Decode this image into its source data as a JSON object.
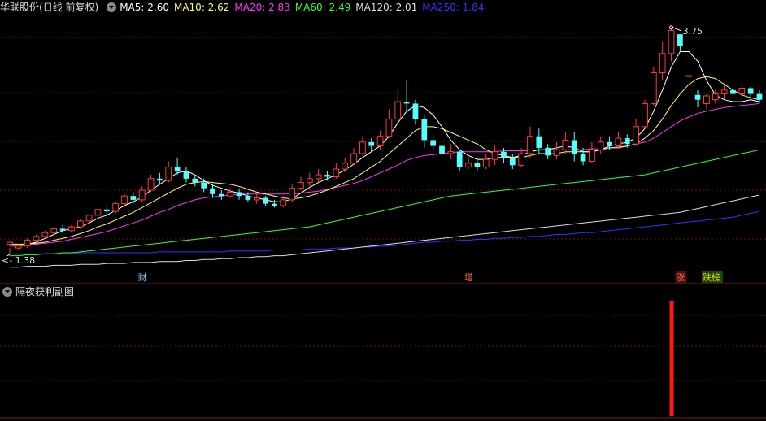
{
  "header": {
    "stock_name": "华联股份",
    "period": "(日线 前复权)",
    "ma": [
      {
        "name": "MA5",
        "value": "2.60",
        "color": "#ffffff"
      },
      {
        "name": "MA10",
        "value": "2.62",
        "color": "#ffff66"
      },
      {
        "name": "MA20",
        "value": "2.83",
        "color": "#ff33ff"
      },
      {
        "name": "MA60",
        "value": "2.49",
        "color": "#33ff33"
      },
      {
        "name": "MA120",
        "value": "2.01",
        "color": "#dddddd"
      },
      {
        "name": "MA250",
        "value": "1.84",
        "color": "#3333ff"
      }
    ]
  },
  "sub_header": {
    "title": "隔夜获利副图"
  },
  "chart_data": {
    "type": "candlestick",
    "ylim": [
      1.25,
      3.85
    ],
    "high_label": "3.75",
    "low_label": "1.38",
    "colors": {
      "up": "#ff3b3b",
      "down": "#54ffff",
      "ma5": "#ffffff",
      "ma10": "#ffff66",
      "ma20": "#ff33ff",
      "ma60": "#33ff33",
      "ma120": "#dddddd",
      "ma250": "#3333ff"
    },
    "candles": [
      [
        1.5,
        1.52,
        1.46,
        1.4
      ],
      [
        1.46,
        1.48,
        1.5,
        1.44
      ],
      [
        1.48,
        1.54,
        1.56,
        1.46
      ],
      [
        1.54,
        1.58,
        1.6,
        1.52
      ],
      [
        1.58,
        1.62,
        1.64,
        1.56
      ],
      [
        1.62,
        1.66,
        1.68,
        1.6
      ],
      [
        1.66,
        1.64,
        1.7,
        1.62
      ],
      [
        1.64,
        1.68,
        1.7,
        1.62
      ],
      [
        1.68,
        1.74,
        1.76,
        1.66
      ],
      [
        1.74,
        1.8,
        1.82,
        1.72
      ],
      [
        1.8,
        1.86,
        1.88,
        1.78
      ],
      [
        1.86,
        1.84,
        1.9,
        1.8
      ],
      [
        1.84,
        1.92,
        1.94,
        1.82
      ],
      [
        1.92,
        2.0,
        2.02,
        1.9
      ],
      [
        2.0,
        1.96,
        2.04,
        1.92
      ],
      [
        1.96,
        2.06,
        2.1,
        1.94
      ],
      [
        2.06,
        2.18,
        2.22,
        2.04
      ],
      [
        2.18,
        2.16,
        2.24,
        2.12
      ],
      [
        2.16,
        2.3,
        2.36,
        2.14
      ],
      [
        2.3,
        2.26,
        2.4,
        2.22
      ],
      [
        2.26,
        2.18,
        2.3,
        2.14
      ],
      [
        2.18,
        2.14,
        2.22,
        2.1
      ],
      [
        2.14,
        2.08,
        2.18,
        2.04
      ],
      [
        2.08,
        2.02,
        2.12,
        1.98
      ],
      [
        2.02,
        2.0,
        2.06,
        1.96
      ],
      [
        2.0,
        2.04,
        2.08,
        1.98
      ],
      [
        2.04,
        2.0,
        2.08,
        1.96
      ],
      [
        2.0,
        1.96,
        2.04,
        1.94
      ],
      [
        1.96,
        1.98,
        2.02,
        1.92
      ],
      [
        1.98,
        1.92,
        2.0,
        1.9
      ],
      [
        1.92,
        1.9,
        1.96,
        1.88
      ],
      [
        1.9,
        1.96,
        2.0,
        1.88
      ],
      [
        1.96,
        2.08,
        2.12,
        1.94
      ],
      [
        2.08,
        2.14,
        2.2,
        2.06
      ],
      [
        2.14,
        2.18,
        2.24,
        2.1
      ],
      [
        2.18,
        2.22,
        2.28,
        2.14
      ],
      [
        2.22,
        2.2,
        2.26,
        2.16
      ],
      [
        2.2,
        2.28,
        2.34,
        2.18
      ],
      [
        2.28,
        2.34,
        2.4,
        2.26
      ],
      [
        2.34,
        2.44,
        2.5,
        2.32
      ],
      [
        2.44,
        2.56,
        2.62,
        2.42
      ],
      [
        2.56,
        2.52,
        2.6,
        2.46
      ],
      [
        2.52,
        2.62,
        2.68,
        2.48
      ],
      [
        2.62,
        2.8,
        2.9,
        2.6
      ],
      [
        2.8,
        2.98,
        3.1,
        2.76
      ],
      [
        2.98,
        2.96,
        3.2,
        2.88
      ],
      [
        2.96,
        2.8,
        3.0,
        2.74
      ],
      [
        2.8,
        2.58,
        2.84,
        2.5
      ],
      [
        2.58,
        2.52,
        2.64,
        2.46
      ],
      [
        2.52,
        2.44,
        2.56,
        2.4
      ],
      [
        2.44,
        2.46,
        2.54,
        2.38
      ],
      [
        2.46,
        2.3,
        2.48,
        2.26
      ],
      [
        2.3,
        2.34,
        2.4,
        2.28
      ],
      [
        2.34,
        2.3,
        2.38,
        2.26
      ],
      [
        2.3,
        2.38,
        2.44,
        2.28
      ],
      [
        2.38,
        2.46,
        2.52,
        2.32
      ],
      [
        2.46,
        2.4,
        2.5,
        2.34
      ],
      [
        2.4,
        2.32,
        2.44,
        2.28
      ],
      [
        2.32,
        2.44,
        2.5,
        2.3
      ],
      [
        2.44,
        2.62,
        2.72,
        2.4
      ],
      [
        2.62,
        2.5,
        2.7,
        2.44
      ],
      [
        2.5,
        2.42,
        2.54,
        2.38
      ],
      [
        2.42,
        2.48,
        2.56,
        2.38
      ],
      [
        2.48,
        2.58,
        2.66,
        2.44
      ],
      [
        2.58,
        2.44,
        2.66,
        2.36
      ],
      [
        2.44,
        2.36,
        2.5,
        2.32
      ],
      [
        2.36,
        2.48,
        2.56,
        2.34
      ],
      [
        2.48,
        2.56,
        2.62,
        2.44
      ],
      [
        2.56,
        2.52,
        2.62,
        2.48
      ],
      [
        2.52,
        2.6,
        2.66,
        2.5
      ],
      [
        2.6,
        2.54,
        2.64,
        2.5
      ],
      [
        2.54,
        2.72,
        2.8,
        2.52
      ],
      [
        2.72,
        2.96,
        3.0,
        2.7
      ],
      [
        2.96,
        3.28,
        3.34,
        2.94
      ],
      [
        3.28,
        3.48,
        3.6,
        3.2
      ],
      [
        3.48,
        3.72,
        3.75,
        3.4
      ],
      [
        3.68,
        3.56,
        3.66,
        3.5
      ],
      [
        3.25,
        3.25,
        3.25,
        3.25
      ],
      [
        3.05,
        3.0,
        3.1,
        2.92
      ],
      [
        2.96,
        3.04,
        3.06,
        2.9
      ],
      [
        3.0,
        3.06,
        3.1,
        2.96
      ],
      [
        3.06,
        3.1,
        3.16,
        3.0
      ],
      [
        3.1,
        3.06,
        3.14,
        3.0
      ],
      [
        3.06,
        3.12,
        3.16,
        3.0
      ],
      [
        3.12,
        3.06,
        3.14,
        3.0
      ],
      [
        3.06,
        3.0,
        3.1,
        2.96
      ]
    ],
    "ma5": [
      1.5,
      1.49,
      1.5,
      1.52,
      1.56,
      1.6,
      1.64,
      1.66,
      1.68,
      1.72,
      1.77,
      1.8,
      1.85,
      1.9,
      1.94,
      1.99,
      2.06,
      2.12,
      2.18,
      2.24,
      2.26,
      2.22,
      2.16,
      2.11,
      2.08,
      2.05,
      2.03,
      2.0,
      1.98,
      1.96,
      1.94,
      1.94,
      1.97,
      2.03,
      2.09,
      2.14,
      2.18,
      2.22,
      2.27,
      2.33,
      2.4,
      2.46,
      2.52,
      2.62,
      2.76,
      2.88,
      2.94,
      2.92,
      2.84,
      2.72,
      2.58,
      2.48,
      2.42,
      2.38,
      2.38,
      2.4,
      2.4,
      2.4,
      2.42,
      2.46,
      2.48,
      2.48,
      2.5,
      2.52,
      2.5,
      2.46,
      2.46,
      2.48,
      2.52,
      2.54,
      2.56,
      2.6,
      2.7,
      2.88,
      3.1,
      3.34,
      3.5,
      3.5,
      3.4,
      3.2,
      3.05,
      3.0,
      2.98,
      2.98,
      3.0,
      2.98
    ],
    "ma10": [
      1.5,
      1.5,
      1.5,
      1.51,
      1.52,
      1.54,
      1.56,
      1.58,
      1.61,
      1.64,
      1.68,
      1.71,
      1.75,
      1.79,
      1.83,
      1.88,
      1.93,
      1.98,
      2.03,
      2.08,
      2.12,
      2.14,
      2.15,
      2.14,
      2.13,
      2.12,
      2.1,
      2.07,
      2.04,
      2.02,
      2.0,
      1.98,
      1.97,
      1.98,
      2.0,
      2.03,
      2.06,
      2.1,
      2.14,
      2.18,
      2.24,
      2.3,
      2.36,
      2.44,
      2.52,
      2.6,
      2.68,
      2.72,
      2.72,
      2.7,
      2.66,
      2.62,
      2.58,
      2.54,
      2.48,
      2.44,
      2.42,
      2.4,
      2.4,
      2.42,
      2.44,
      2.44,
      2.44,
      2.46,
      2.46,
      2.46,
      2.46,
      2.48,
      2.5,
      2.5,
      2.52,
      2.54,
      2.6,
      2.68,
      2.8,
      2.94,
      3.06,
      3.16,
      3.22,
      3.24,
      3.22,
      3.16,
      3.1,
      3.05,
      3.02,
      3.0
    ],
    "ma20": [
      1.48,
      1.48,
      1.49,
      1.5,
      1.51,
      1.52,
      1.53,
      1.55,
      1.57,
      1.59,
      1.61,
      1.63,
      1.66,
      1.69,
      1.72,
      1.75,
      1.79,
      1.83,
      1.86,
      1.9,
      1.93,
      1.96,
      1.98,
      1.99,
      2.0,
      2.01,
      2.02,
      2.02,
      2.02,
      2.02,
      2.02,
      2.02,
      2.02,
      2.03,
      2.04,
      2.05,
      2.07,
      2.09,
      2.11,
      2.13,
      2.16,
      2.2,
      2.24,
      2.28,
      2.32,
      2.37,
      2.4,
      2.42,
      2.43,
      2.44,
      2.45,
      2.46,
      2.46,
      2.46,
      2.46,
      2.46,
      2.47,
      2.47,
      2.47,
      2.47,
      2.48,
      2.48,
      2.48,
      2.48,
      2.48,
      2.48,
      2.49,
      2.49,
      2.5,
      2.51,
      2.52,
      2.54,
      2.56,
      2.6,
      2.66,
      2.72,
      2.78,
      2.82,
      2.86,
      2.88,
      2.9,
      2.92,
      2.93,
      2.94,
      2.95,
      2.96
    ],
    "ma60": [
      1.38,
      1.38,
      1.39,
      1.39,
      1.4,
      1.4,
      1.41,
      1.41,
      1.42,
      1.43,
      1.44,
      1.45,
      1.46,
      1.47,
      1.48,
      1.49,
      1.5,
      1.51,
      1.52,
      1.53,
      1.54,
      1.55,
      1.56,
      1.57,
      1.58,
      1.59,
      1.6,
      1.61,
      1.62,
      1.63,
      1.64,
      1.65,
      1.66,
      1.67,
      1.68,
      1.7,
      1.72,
      1.74,
      1.76,
      1.78,
      1.8,
      1.82,
      1.84,
      1.86,
      1.88,
      1.9,
      1.92,
      1.94,
      1.96,
      1.98,
      2.0,
      2.01,
      2.02,
      2.03,
      2.04,
      2.05,
      2.06,
      2.07,
      2.08,
      2.09,
      2.1,
      2.11,
      2.12,
      2.13,
      2.14,
      2.15,
      2.16,
      2.17,
      2.18,
      2.19,
      2.2,
      2.21,
      2.22,
      2.24,
      2.26,
      2.28,
      2.3,
      2.32,
      2.34,
      2.36,
      2.38,
      2.4,
      2.42,
      2.44,
      2.46,
      2.48
    ],
    "ma120": [
      1.26,
      1.26,
      1.27,
      1.27,
      1.27,
      1.28,
      1.28,
      1.28,
      1.29,
      1.29,
      1.29,
      1.3,
      1.3,
      1.3,
      1.31,
      1.31,
      1.31,
      1.32,
      1.32,
      1.32,
      1.33,
      1.33,
      1.34,
      1.34,
      1.35,
      1.35,
      1.36,
      1.36,
      1.37,
      1.37,
      1.38,
      1.38,
      1.39,
      1.4,
      1.41,
      1.42,
      1.43,
      1.44,
      1.45,
      1.46,
      1.47,
      1.48,
      1.49,
      1.5,
      1.51,
      1.52,
      1.53,
      1.54,
      1.55,
      1.56,
      1.57,
      1.58,
      1.59,
      1.6,
      1.61,
      1.62,
      1.63,
      1.64,
      1.65,
      1.66,
      1.67,
      1.68,
      1.69,
      1.7,
      1.71,
      1.72,
      1.73,
      1.74,
      1.75,
      1.76,
      1.77,
      1.78,
      1.79,
      1.8,
      1.81,
      1.82,
      1.83,
      1.85,
      1.87,
      1.89,
      1.91,
      1.93,
      1.95,
      1.97,
      1.99,
      2.01
    ],
    "ma250": [
      1.4,
      1.4,
      1.4,
      1.4,
      1.4,
      1.4,
      1.4,
      1.4,
      1.41,
      1.41,
      1.41,
      1.41,
      1.41,
      1.41,
      1.41,
      1.41,
      1.41,
      1.42,
      1.42,
      1.42,
      1.42,
      1.42,
      1.42,
      1.42,
      1.42,
      1.43,
      1.43,
      1.43,
      1.43,
      1.43,
      1.44,
      1.44,
      1.44,
      1.44,
      1.45,
      1.45,
      1.45,
      1.46,
      1.46,
      1.46,
      1.47,
      1.47,
      1.48,
      1.48,
      1.49,
      1.5,
      1.51,
      1.52,
      1.52,
      1.53,
      1.53,
      1.54,
      1.54,
      1.55,
      1.55,
      1.56,
      1.56,
      1.57,
      1.57,
      1.58,
      1.58,
      1.59,
      1.6,
      1.6,
      1.61,
      1.62,
      1.62,
      1.63,
      1.64,
      1.65,
      1.66,
      1.67,
      1.68,
      1.69,
      1.7,
      1.71,
      1.72,
      1.73,
      1.74,
      1.75,
      1.76,
      1.77,
      1.78,
      1.8,
      1.82,
      1.84
    ],
    "tags": [
      {
        "text": "财",
        "index": 15,
        "color": "#66ccff"
      },
      {
        "text": "增",
        "index": 52,
        "color": "#ff6644"
      },
      {
        "text": "涨",
        "index": 76,
        "color": "#ff6644",
        "bg": "#4a1010"
      },
      {
        "text": "跌榜",
        "index": 79,
        "color": "#ffcc00",
        "bg": "#0f4a10"
      }
    ],
    "sub_bars": [
      {
        "index": 75,
        "value": 1.0
      }
    ]
  }
}
